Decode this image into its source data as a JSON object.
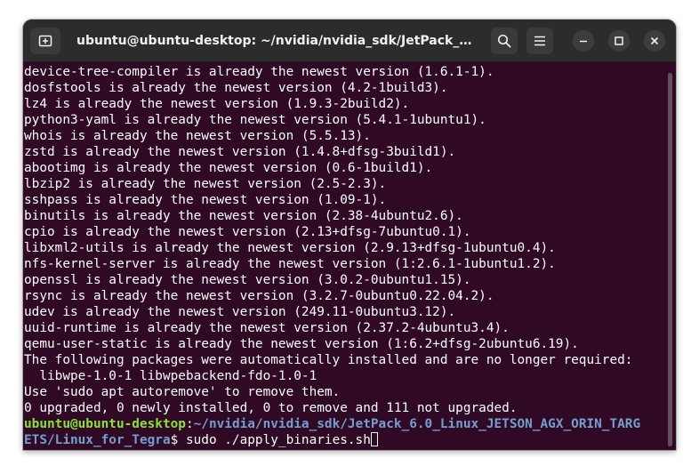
{
  "window": {
    "title": "ubuntu@ubuntu-desktop: ~/nvidia/nvidia_sdk/JetPack_6.0_Li..."
  },
  "icons": {
    "new_tab": "new-tab-icon",
    "search": "search-icon",
    "menu": "hamburger-menu-icon",
    "minimize": "minimize-icon",
    "maximize": "maximize-icon",
    "close": "close-icon"
  },
  "colors": {
    "terminal_bg": "#300a24",
    "prompt_user": "#8ae234",
    "prompt_path": "#729fcf",
    "titlebar_bg": "#2c2c2c"
  },
  "terminal": {
    "lines": [
      "device-tree-compiler is already the newest version (1.6.1-1).",
      "dosfstools is already the newest version (4.2-1build3).",
      "lz4 is already the newest version (1.9.3-2build2).",
      "python3-yaml is already the newest version (5.4.1-1ubuntu1).",
      "whois is already the newest version (5.5.13).",
      "zstd is already the newest version (1.4.8+dfsg-3build1).",
      "abootimg is already the newest version (0.6-1build1).",
      "lbzip2 is already the newest version (2.5-2.3).",
      "sshpass is already the newest version (1.09-1).",
      "binutils is already the newest version (2.38-4ubuntu2.6).",
      "cpio is already the newest version (2.13+dfsg-7ubuntu0.1).",
      "libxml2-utils is already the newest version (2.9.13+dfsg-1ubuntu0.4).",
      "nfs-kernel-server is already the newest version (1:2.6.1-1ubuntu1.2).",
      "openssl is already the newest version (3.0.2-0ubuntu1.15).",
      "rsync is already the newest version (3.2.7-0ubuntu0.22.04.2).",
      "udev is already the newest version (249.11-0ubuntu3.12).",
      "uuid-runtime is already the newest version (2.37.2-4ubuntu3.4).",
      "qemu-user-static is already the newest version (1:6.2+dfsg-2ubuntu6.19).",
      "The following packages were automatically installed and are no longer required:",
      "  libwpe-1.0-1 libwpebackend-fdo-1.0-1",
      "Use 'sudo apt autoremove' to remove them.",
      "0 upgraded, 0 newly installed, 0 to remove and 111 not upgraded."
    ],
    "prompt": {
      "user_host": "ubuntu@ubuntu-desktop",
      "colon": ":",
      "path_part1": "~/nvidia/nvidia_sdk/JetPack_6.0_Linux_JETSON_AGX_ORIN_TARG",
      "path_part2": "ETS/Linux_for_Tegra",
      "symbol": "$ ",
      "command": "sudo ./apply_binaries.sh"
    }
  }
}
